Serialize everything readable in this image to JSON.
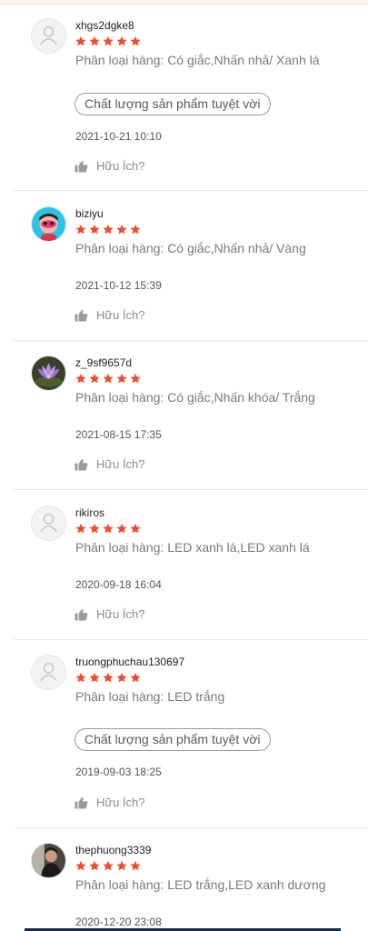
{
  "colors": {
    "star": "#ee4d2d",
    "text_muted": "#7a7a7a",
    "tag_border": "#9a9a9a"
  },
  "icons": {
    "star": "star-icon",
    "helpful": "thumbs-up-icon",
    "default_avatar": "user-icon"
  },
  "reviews": [
    {
      "username": "xhgs2dgke8",
      "rating": 5,
      "variation": "Phân loại hàng: Có giắc,Nhấn nhả/ Xanh lá",
      "tag": "Chất lượng sản phẩm tuyệt vời",
      "date": "2021-10-21 10:10",
      "helpful_label": "Hữu Ích?"
    },
    {
      "username": "biziyu",
      "rating": 5,
      "variation": "Phân loại hàng: Có giắc,Nhấn nhả/ Vàng",
      "date": "2021-10-12 15:39",
      "helpful_label": "Hữu Ích?"
    },
    {
      "username": "z_9sf9657d",
      "rating": 5,
      "variation": "Phân loại hàng: Có giắc,Nhấn khóa/ Trắng",
      "date": "2021-08-15 17:35",
      "helpful_label": "Hữu Ích?"
    },
    {
      "username": "rikiros",
      "rating": 5,
      "variation": "Phân loại hàng: LED xanh lá,LED xanh lá",
      "date": "2020-09-18 16:04",
      "helpful_label": "Hữu Ích?"
    },
    {
      "username": "truongphuchau130697",
      "rating": 5,
      "variation": "Phân loại hàng: LED trắng",
      "tag": "Chất lượng sản phẩm tuyệt vời",
      "date": "2019-09-03 18:25",
      "helpful_label": "Hữu Ích?"
    },
    {
      "username": "thephuong3339",
      "rating": 5,
      "variation": "Phân loại hàng: LED trắng,LED xanh dương",
      "date": "2020-12-20 23:08"
    }
  ]
}
